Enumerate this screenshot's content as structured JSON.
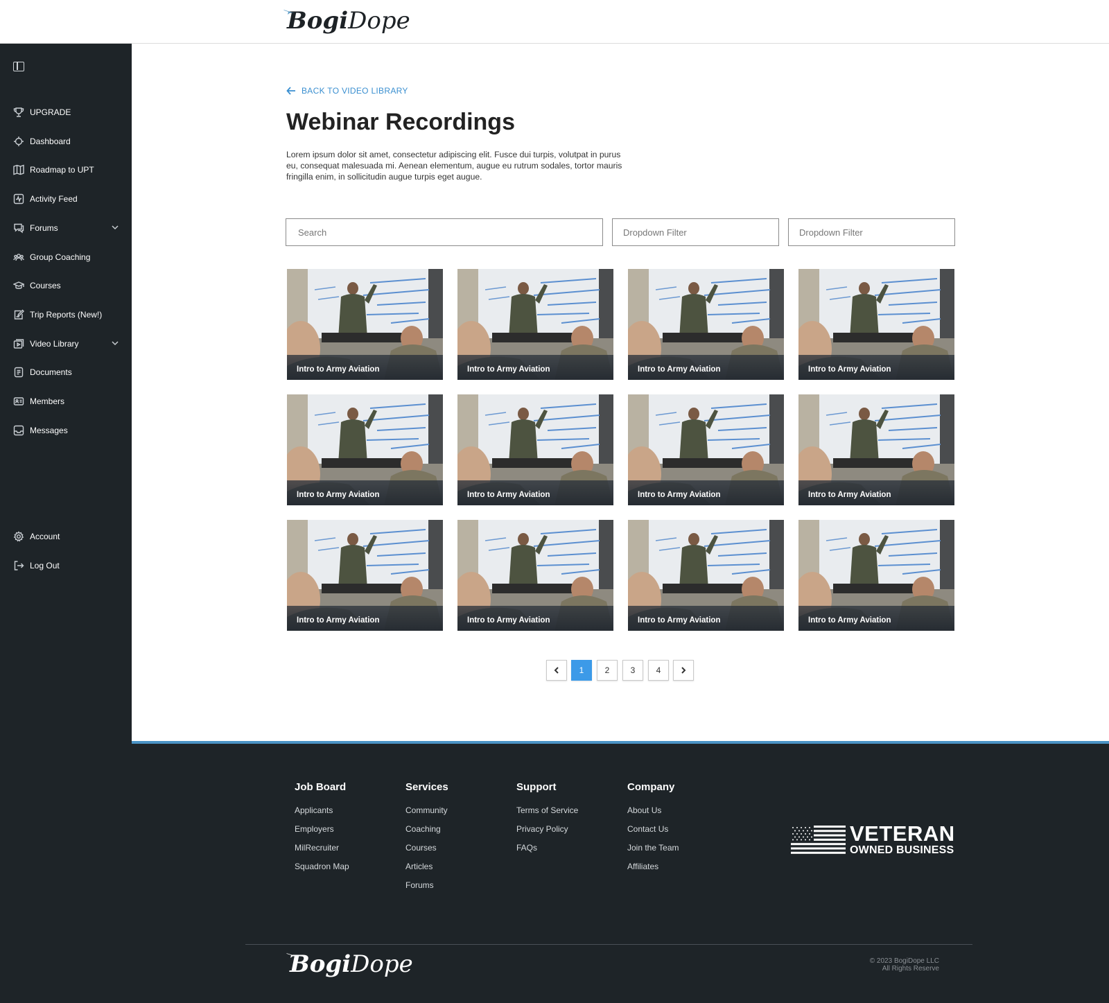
{
  "header": {
    "logo_text_bold": "Bogi",
    "logo_text_rest": "Dope"
  },
  "sidebar": {
    "items": [
      {
        "label": "UPGRADE",
        "icon": "trophy-icon"
      },
      {
        "label": "Dashboard",
        "icon": "crosshair-icon"
      },
      {
        "label": "Roadmap to UPT",
        "icon": "map-icon"
      },
      {
        "label": "Activity Feed",
        "icon": "activity-icon"
      },
      {
        "label": "Forums",
        "icon": "chat-icon",
        "expandable": true
      },
      {
        "label": "Group Coaching",
        "icon": "group-icon"
      },
      {
        "label": "Courses",
        "icon": "graduation-cap-icon"
      },
      {
        "label": "Trip Reports (New!)",
        "icon": "report-icon"
      },
      {
        "label": "Video Library",
        "icon": "video-library-icon",
        "expandable": true
      },
      {
        "label": "Documents",
        "icon": "document-icon"
      },
      {
        "label": "Members",
        "icon": "id-card-icon"
      },
      {
        "label": "Messages",
        "icon": "inbox-icon"
      }
    ],
    "bottom_items": [
      {
        "label": "Account",
        "icon": "gear-icon"
      },
      {
        "label": "Log Out",
        "icon": "logout-icon"
      }
    ]
  },
  "main": {
    "back_link": "BACK TO VIDEO LIBRARY",
    "title": "Webinar Recordings",
    "description": "Lorem ipsum dolor sit amet, consectetur adipiscing elit. Fusce dui turpis, volutpat in purus eu, consequat malesuada mi. Aenean elementum, augue eu rutrum sodales, tortor mauris fringilla enim, in sollicitudin augue turpis eget augue.",
    "search_placeholder": "Search",
    "filters": [
      "Dropdown Filter",
      "Dropdown Filter"
    ],
    "videos": [
      "Intro to Army Aviation",
      "Intro to Army Aviation",
      "Intro to Army Aviation",
      "Intro to Army Aviation",
      "Intro to Army Aviation",
      "Intro to Army Aviation",
      "Intro to Army Aviation",
      "Intro to Army Aviation",
      "Intro to Army Aviation",
      "Intro to Army Aviation",
      "Intro to Army Aviation",
      "Intro to Army Aviation"
    ],
    "pagination": {
      "pages": [
        "1",
        "2",
        "3",
        "4"
      ],
      "current": "1"
    }
  },
  "footer": {
    "columns": [
      {
        "heading": "Job Board",
        "links": [
          "Applicants",
          "Employers",
          "MilRecruiter",
          "Squadron Map"
        ]
      },
      {
        "heading": "Services",
        "links": [
          "Community",
          "Coaching",
          "Courses",
          "Articles",
          "Forums"
        ]
      },
      {
        "heading": "Support",
        "links": [
          "Terms of Service",
          "Privacy Policy",
          "FAQs"
        ]
      },
      {
        "heading": "Company",
        "links": [
          "About Us",
          "Contact Us",
          "Join the Team",
          "Affiliates"
        ]
      }
    ],
    "badge_line1": "VETERAN",
    "badge_line2": "OWNED BUSINESS",
    "copyright_line1": "© 2023 BogiDope LLC",
    "copyright_line2": "All Rights Reserve"
  },
  "colors": {
    "sidebar_bg": "#1e2428",
    "accent_blue": "#3a8fd0",
    "active_page": "#3c9ae8",
    "footer_rule": "#4b93c5"
  }
}
